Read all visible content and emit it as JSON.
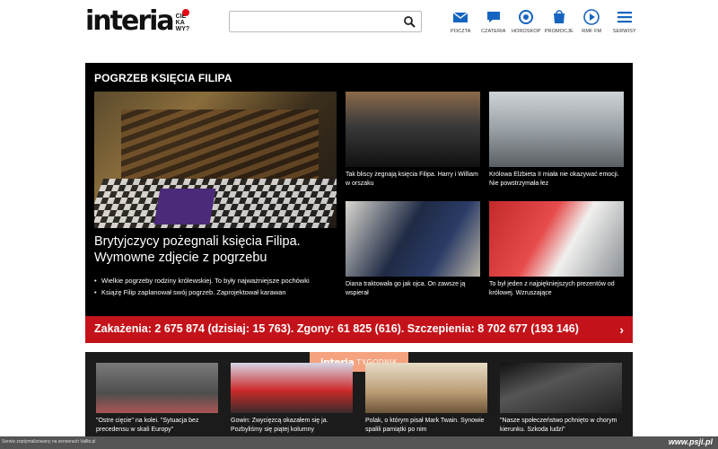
{
  "header": {
    "logo_word": "interia",
    "logo_tag": "CIE KA WY?",
    "search_placeholder": "",
    "nav": [
      {
        "label": "POCZTA",
        "icon": "mail-icon"
      },
      {
        "label": "CZATERIA",
        "icon": "chat-icon"
      },
      {
        "label": "HOROSKOP",
        "icon": "horoscope-icon"
      },
      {
        "label": "PROMOCJE",
        "icon": "promotions-icon"
      },
      {
        "label": "RMF FM",
        "icon": "play-icon"
      },
      {
        "label": "SERWISY",
        "icon": "menu-icon"
      }
    ],
    "accent": "#1565c0"
  },
  "main": {
    "title": "POGRZEB KSIĘCIA FILIPA",
    "headline": "Brytyjczycy pożegnali księcia Filipa. Wymowne zdjęcie z pogrzebu",
    "bullets": [
      "Wielkie pogrzeby rodziny królewskiej. To były najważniejsze pochówki",
      "Książę Filip zaplanował swój pogrzeb. Zaprojektował karawan"
    ],
    "thumbs": [
      "Tak bliscy żegnają księcia Filipa. Harry i William w orszaku",
      "Królowa Elżbieta II miała nie okazywać emocji. Nie powstrzymała łez",
      "Diana traktowała go jak ojca. On zawsze ją wspierał",
      "To był jeden z najpiękniejszych prezentów od królowej. Wzruszające"
    ]
  },
  "covid": {
    "text": "Zakażenia: 2 675 874 (dzisiaj: 15 763). Zgony: 61 825 (616). Szczepienia: 8 702 677 (193 146)",
    "arrow": "›",
    "color": "#c4121a"
  },
  "tygodnik": {
    "brand": "interia",
    "brand_sub": "TYGODNIK",
    "cards": [
      "\"Ostre cięcie\" na kolei. \"Sytuacja bez precedensu w skali Europy\"",
      "Gowin: Zwycięzcą okazałem się ja. Pozbyliśmy się piątej kolumny",
      "Polak, o którym pisał Mark Twain. Synowie spalili pamiątki po nim",
      "\"Nasze społeczeństwo pchnięto w chorym kierunku. Szkoda ludzi\""
    ]
  },
  "footer": {
    "left": "Serwis zoptymalizowany na serwerach Vallbi.pl",
    "right": "www.psji.pl"
  }
}
